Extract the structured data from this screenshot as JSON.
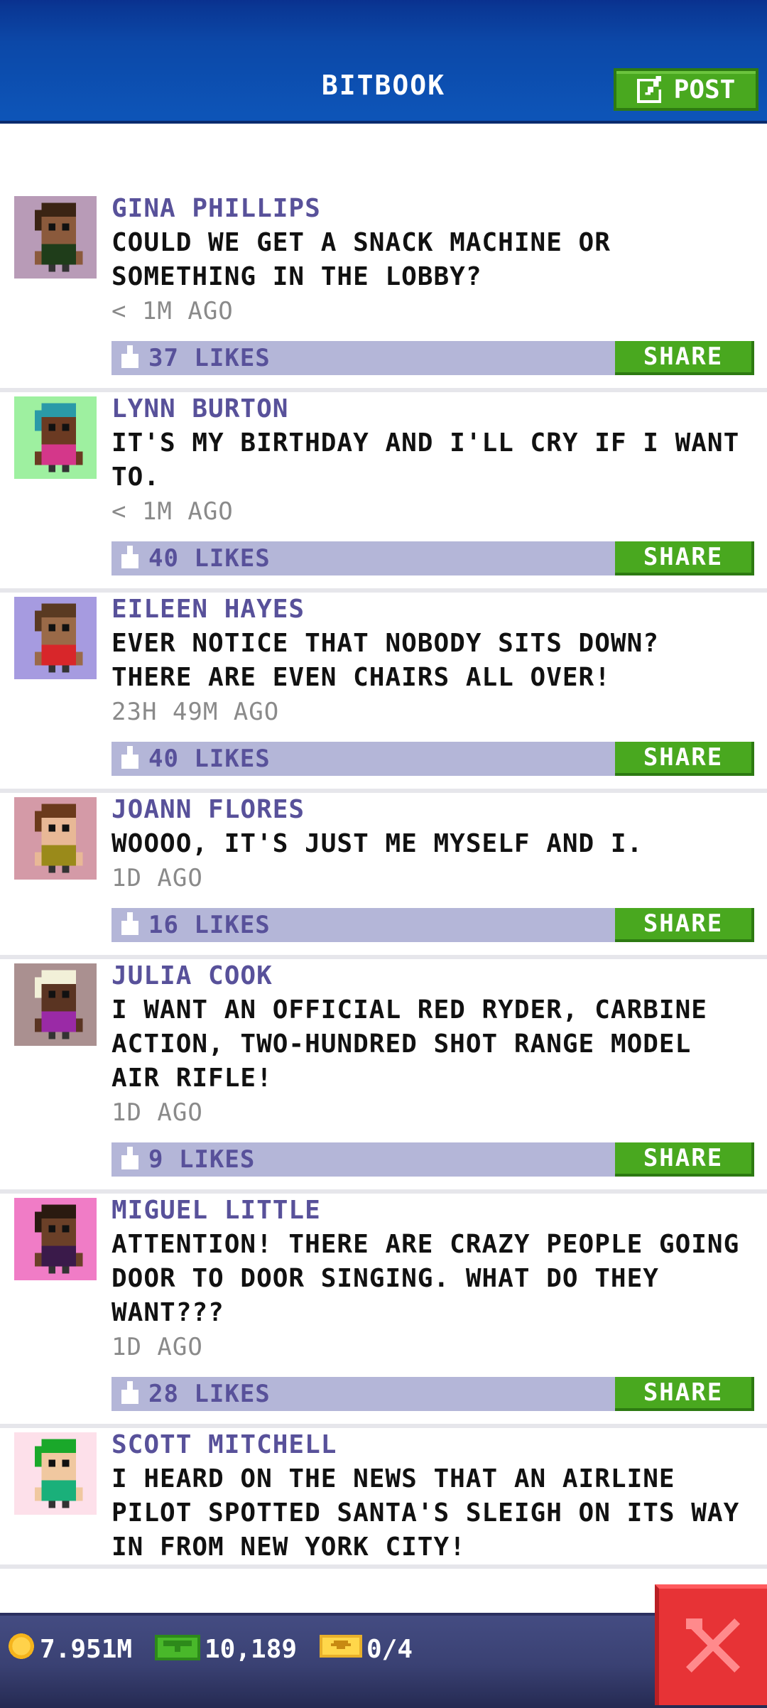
{
  "header": {
    "title": "BITBOOK",
    "post_label": "POST",
    "post_icon": "edit-icon"
  },
  "posts": [
    {
      "name": "GINA PHILLIPS",
      "text": "COULD WE GET A SNACK MACHINE OR SOMETHING IN THE LOBBY?",
      "time": "< 1M AGO",
      "likes": "37 LIKES",
      "share": "SHARE",
      "avatar_bg": "#b89bb7",
      "skin": "#8b5a3c",
      "hair": "#3b2414",
      "shirt": "#1f3d1a"
    },
    {
      "name": "LYNN BURTON",
      "text": "IT'S MY BIRTHDAY AND I'LL CRY IF I WANT TO.",
      "time": "< 1M AGO",
      "likes": "40 LIKES",
      "share": "SHARE",
      "avatar_bg": "#9ef0a0",
      "skin": "#6b3a22",
      "hair": "#2a9aa8",
      "shirt": "#d4378a"
    },
    {
      "name": "EILEEN HAYES",
      "text": "EVER NOTICE THAT NOBODY SITS DOWN? THERE ARE EVEN CHAIRS ALL OVER!",
      "time": "23H 49M AGO",
      "likes": "40 LIKES",
      "share": "SHARE",
      "avatar_bg": "#a69be0",
      "skin": "#9a6a48",
      "hair": "#5a3a22",
      "shirt": "#d8262a"
    },
    {
      "name": "JOANN FLORES",
      "text": "WOOOO, IT'S JUST ME MYSELF AND I.",
      "time": "1D AGO",
      "likes": "16 LIKES",
      "share": "SHARE",
      "avatar_bg": "#d49aa7",
      "skin": "#e8b896",
      "hair": "#6b3a1c",
      "shirt": "#9a8a1a"
    },
    {
      "name": "JULIA COOK",
      "text": "I WANT AN OFFICIAL RED RYDER, CARBINE ACTION, TWO-HUNDRED SHOT RANGE MODEL AIR RIFLE!",
      "time": "1D AGO",
      "likes": "9 LIKES",
      "share": "SHARE",
      "avatar_bg": "#aa9090",
      "skin": "#5a3422",
      "hair": "#f2f0d8",
      "shirt": "#9a2aa6"
    },
    {
      "name": "MIGUEL LITTLE",
      "text": "ATTENTION! THERE ARE CRAZY PEOPLE GOING DOOR TO DOOR SINGING. WHAT DO THEY WANT???",
      "time": "1D AGO",
      "likes": "28 LIKES",
      "share": "SHARE",
      "avatar_bg": "#f07cc6",
      "skin": "#6b4028",
      "hair": "#2a1a10",
      "shirt": "#3a1a4a"
    },
    {
      "name": "SCOTT MITCHELL",
      "text": "I HEARD ON THE NEWS THAT AN AIRLINE PILOT SPOTTED SANTA'S SLEIGH ON ITS WAY IN FROM NEW YORK CITY!",
      "time": "",
      "likes": "",
      "share": "",
      "avatar_bg": "#fde0ea",
      "skin": "#f0c8a0",
      "hair": "#1aa82a",
      "shirt": "#1ab07a"
    }
  ],
  "bottom_bar": {
    "coins": "7.951M",
    "bux": "10,189",
    "tickets": "0/4",
    "coin_icon": "coin-icon",
    "bux_icon": "bux-icon",
    "ticket_icon": "ticket-icon",
    "close_icon": "close-icon"
  },
  "colors": {
    "header_blue": "#0d54b7",
    "green": "#49a81f",
    "name_purple": "#58519a",
    "likes_bar": "#b4b6d8",
    "close_red": "#e73336"
  }
}
